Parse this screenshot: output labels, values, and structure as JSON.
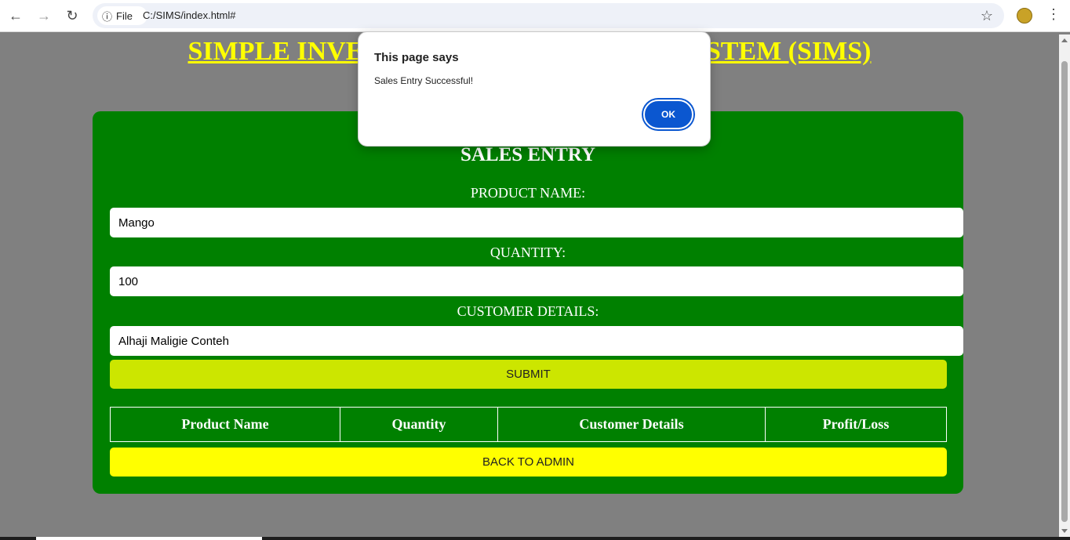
{
  "browser": {
    "back_icon": "←",
    "forward_icon": "→",
    "reload_icon": "↻",
    "info_icon": "ⓘ",
    "site_chip_label": "File",
    "url": "C:/SIMS/index.html#",
    "star_icon": "☆",
    "menu_icon": "⋮"
  },
  "page": {
    "site_title": "SIMPLE INVENTORY MANAGEMENT SYSTEM (SIMS)",
    "form": {
      "title": "SALES ENTRY",
      "product_name_label": "PRODUCT NAME:",
      "product_name_value": "Mango",
      "quantity_label": "QUANTITY:",
      "quantity_value": "100",
      "customer_details_label": "CUSTOMER DETAILS:",
      "customer_details_value": "Alhaji Maligie Conteh",
      "submit_label": "SUBMIT"
    },
    "table": {
      "headers": [
        "Product Name",
        "Quantity",
        "Customer Details",
        "Profit/Loss"
      ]
    },
    "back_label": "BACK TO ADMIN"
  },
  "dialog": {
    "title": "This page says",
    "message": "Sales Entry Successful!",
    "ok_label": "OK"
  },
  "colors": {
    "page_bg": "#808080",
    "panel_bg": "#008000",
    "title_color": "#ffff00",
    "submit_bg": "#cce600",
    "back_bg": "#ffff00",
    "dialog_button": "#0b57d0"
  }
}
